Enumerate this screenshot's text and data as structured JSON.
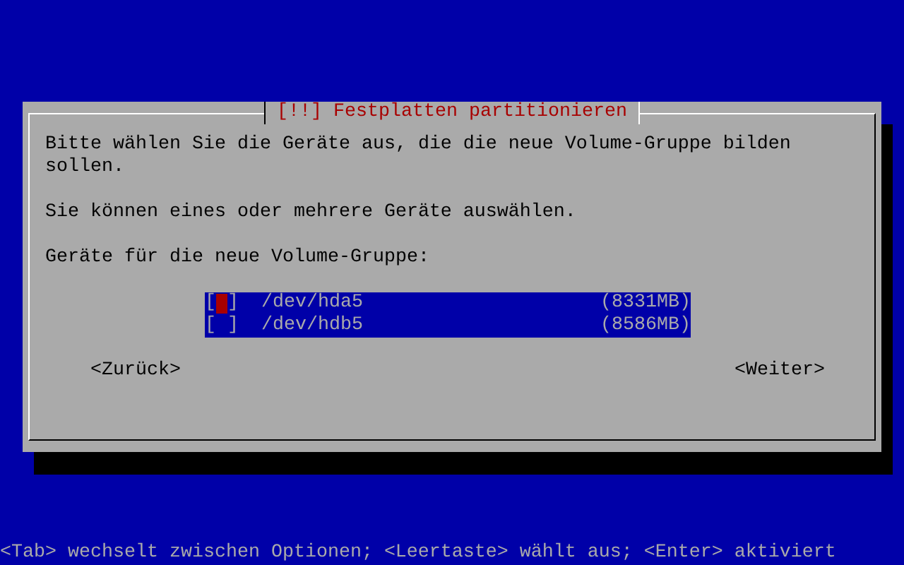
{
  "dialog": {
    "title": "[!!] Festplatten partitionieren",
    "paragraphs": [
      "Bitte wählen Sie die Geräte aus, die die neue Volume-Gruppe bilden sollen.",
      "Sie können eines oder mehrere Geräte auswählen.",
      "Geräte für die neue Volume-Gruppe:"
    ],
    "devices": [
      {
        "checkbox": "[ ]",
        "checked": false,
        "focused": true,
        "device": "/dev/hda5",
        "size": "(8331MB)"
      },
      {
        "checkbox": "[ ]",
        "checked": false,
        "focused": false,
        "device": "/dev/hdb5",
        "size": "(8586MB)"
      }
    ],
    "buttons": [
      {
        "label": "<Zurück>"
      },
      {
        "label": "<Weiter>"
      }
    ]
  },
  "status_bar": "<Tab> wechselt zwischen Optionen; <Leertaste> wählt aus; <Enter> aktiviert"
}
